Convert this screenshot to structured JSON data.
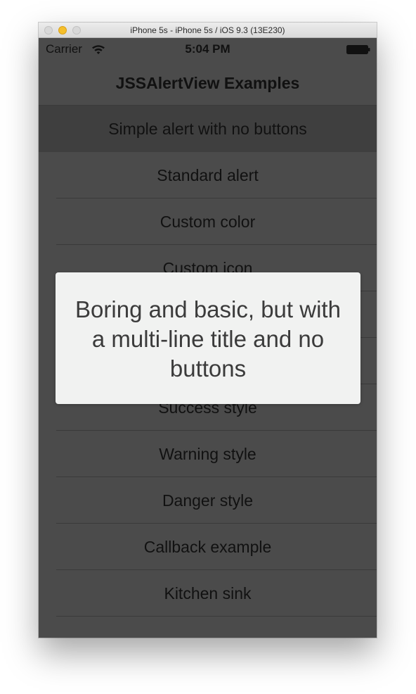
{
  "window": {
    "title": "iPhone 5s - iPhone 5s / iOS 9.3 (13E230)"
  },
  "statusbar": {
    "carrier": "Carrier",
    "time": "5:04 PM",
    "wifi_icon": "wifi-icon",
    "battery_icon": "battery-icon"
  },
  "navbar": {
    "title": "JSSAlertView Examples"
  },
  "list": {
    "items": [
      {
        "label": "Simple alert with no buttons"
      },
      {
        "label": "Standard alert"
      },
      {
        "label": "Custom color"
      },
      {
        "label": "Custom icon"
      },
      {
        "label": ""
      },
      {
        "label": ""
      },
      {
        "label": "Success style"
      },
      {
        "label": "Warning style"
      },
      {
        "label": "Danger style"
      },
      {
        "label": "Callback example"
      },
      {
        "label": "Kitchen sink"
      }
    ]
  },
  "alert": {
    "title": "Boring and basic, but with a multi-line title and no buttons"
  },
  "colors": {
    "background": "#4b4b4b",
    "selected_row": "#3f3f3f",
    "alert_background": "#f1f2f1",
    "minimize_button": "#f5bf2b"
  }
}
